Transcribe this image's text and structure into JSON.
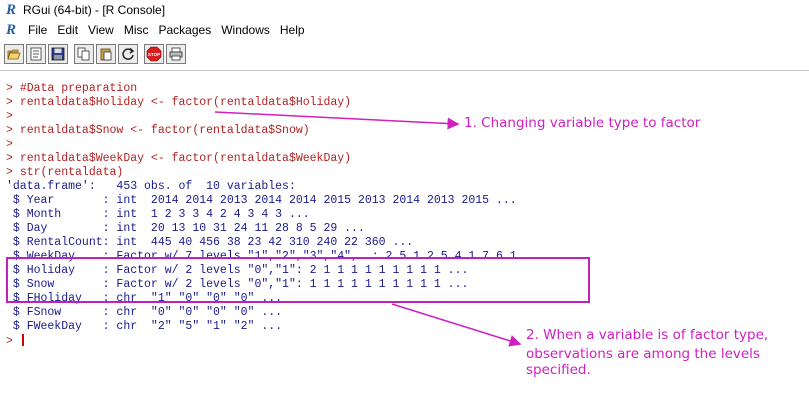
{
  "window": {
    "title": "RGui (64-bit) - [R Console]"
  },
  "menu": [
    "File",
    "Edit",
    "View",
    "Misc",
    "Packages",
    "Windows",
    "Help"
  ],
  "toolbar_icons": [
    "open-script-icon",
    "load-workspace-icon",
    "save-workspace-icon",
    "copy-icon",
    "copy-paste-icon",
    "refresh-icon",
    "stop-icon",
    "print-icon"
  ],
  "stop_label": "STOP",
  "console": {
    "lines": [
      {
        "prompt": "> ",
        "text": "#Data preparation",
        "kind": "input"
      },
      {
        "prompt": "> ",
        "text": "rentaldata$Holiday <- factor(rentaldata$Holiday)",
        "kind": "input"
      },
      {
        "prompt": "> ",
        "text": "",
        "kind": "input"
      },
      {
        "prompt": "> ",
        "text": "rentaldata$Snow <- factor(rentaldata$Snow)",
        "kind": "input"
      },
      {
        "prompt": "> ",
        "text": "",
        "kind": "input"
      },
      {
        "prompt": "> ",
        "text": "rentaldata$WeekDay <- factor(rentaldata$WeekDay)",
        "kind": "input"
      },
      {
        "prompt": "> ",
        "text": "str(rentaldata)",
        "kind": "input"
      },
      {
        "prompt": "",
        "text": "'data.frame':   453 obs. of  10 variables:",
        "kind": "output"
      },
      {
        "prompt": "",
        "text": " $ Year       : int  2014 2014 2013 2014 2014 2015 2013 2014 2013 2015 ...",
        "kind": "output"
      },
      {
        "prompt": "",
        "text": " $ Month      : int  1 2 3 3 4 2 4 3 4 3 ...",
        "kind": "output"
      },
      {
        "prompt": "",
        "text": " $ Day        : int  20 13 10 31 24 11 28 8 5 29 ...",
        "kind": "output"
      },
      {
        "prompt": "",
        "text": " $ RentalCount: int  445 40 456 38 23 42 310 240 22 360 ...",
        "kind": "output"
      },
      {
        "prompt": "",
        "text": " $ WeekDay    : Factor w/ 7 levels \"1\",\"2\",\"3\",\"4\",..: 2 5 1 2 5 4 1 7 6 1 ...",
        "kind": "output"
      },
      {
        "prompt": "",
        "text": " $ Holiday    : Factor w/ 2 levels \"0\",\"1\": 2 1 1 1 1 1 1 1 1 1 ...",
        "kind": "output"
      },
      {
        "prompt": "",
        "text": " $ Snow       : Factor w/ 2 levels \"0\",\"1\": 1 1 1 1 1 1 1 1 1 1 ...",
        "kind": "output"
      },
      {
        "prompt": "",
        "text": " $ FHoliday   : chr  \"1\" \"0\" \"0\" \"0\" ...",
        "kind": "output"
      },
      {
        "prompt": "",
        "text": " $ FSnow      : chr  \"0\" \"0\" \"0\" \"0\" ...",
        "kind": "output"
      },
      {
        "prompt": "",
        "text": " $ FWeekDay   : chr  \"2\" \"5\" \"1\" \"2\" ...",
        "kind": "output"
      },
      {
        "prompt": "> ",
        "text": "",
        "kind": "input"
      }
    ]
  },
  "annotations": {
    "note1": "1. Changing variable type to factor",
    "note2_line1": "2. When a variable is of factor type,",
    "note2_line2": "observations are among the levels specified."
  },
  "colors": {
    "input_text": "#b22222",
    "output_text": "#1a1a8c",
    "annotation": "#d020c0"
  }
}
